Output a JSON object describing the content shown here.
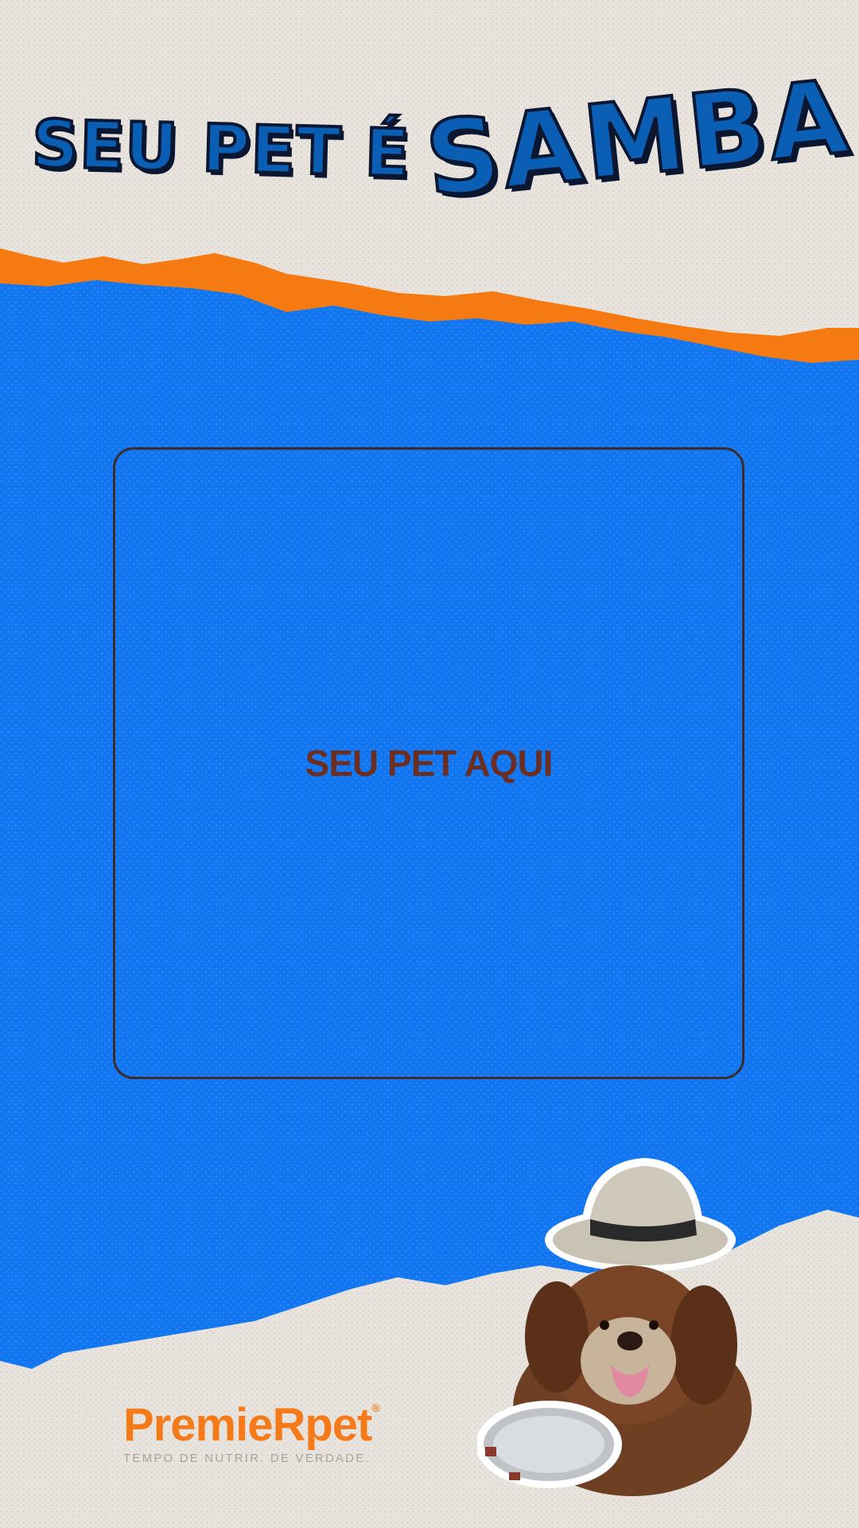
{
  "headline": {
    "left": "SEU PET É",
    "right": "SAMBA"
  },
  "photo_frame": {
    "label": "SEU PET AQUI"
  },
  "brand": {
    "name": "PremieRpet",
    "registered": "®",
    "tagline": "TEMPO DE NUTRIR. DE VERDADE."
  },
  "colors": {
    "paper": "#e8e4dd",
    "blue": "#1176f0",
    "orange": "#f57a12",
    "headline_blue": "#0a5fb4",
    "frame_border": "#3d2b2b",
    "frame_text": "#6b2e22"
  },
  "illustration": {
    "subject": "dog-with-hat-and-tambourine"
  }
}
